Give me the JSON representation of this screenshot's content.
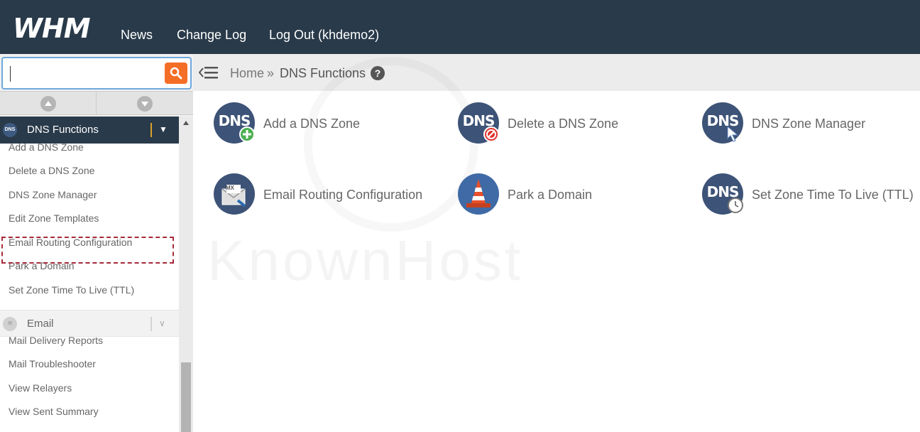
{
  "header": {
    "logo": "WHM",
    "nav": [
      {
        "label": "News"
      },
      {
        "label": "Change Log"
      },
      {
        "label": "Log Out (khdemo2)"
      }
    ]
  },
  "search": {
    "value": "",
    "placeholder": ""
  },
  "sidebar": {
    "categories": [
      {
        "icon_text": "DNS",
        "label": "DNS Functions",
        "items": [
          "Add a DNS Zone",
          "Delete a DNS Zone",
          "DNS Zone Manager",
          "Edit Zone Templates",
          "Email Routing Configuration",
          "Park a Domain",
          "Set Zone Time To Live (TTL)"
        ]
      },
      {
        "label": "Email",
        "items": [
          "Mail Delivery Reports",
          "Mail Troubleshooter",
          "View Relayers",
          "View Sent Summary"
        ]
      }
    ],
    "highlighted_item": "Email Routing Configuration"
  },
  "breadcrumb": {
    "home": "Home",
    "separator": "»",
    "current": "DNS Functions",
    "help": "?"
  },
  "watermark": {
    "text": "KnownHost"
  },
  "tiles": [
    {
      "label": "Add a DNS Zone",
      "icon_text": "DNS",
      "icon": "dns-add-icon"
    },
    {
      "label": "Delete a DNS Zone",
      "icon_text": "DNS",
      "icon": "dns-delete-icon"
    },
    {
      "label": "DNS Zone Manager",
      "icon_text": "DNS",
      "icon": "dns-zone-manager-icon"
    },
    {
      "label": "Email Routing Configuration",
      "icon_text": "MX",
      "icon": "email-routing-icon"
    },
    {
      "label": "Park a Domain",
      "icon": "traffic-cone-icon"
    },
    {
      "label": "Set Zone Time To Live (TTL)",
      "icon_text": "DNS",
      "icon": "dns-ttl-icon"
    }
  ],
  "colors": {
    "header_bg": "#293a4a",
    "accent_orange": "#f56e26",
    "highlight_border": "#a62a3a",
    "icon_navy": "#3d5377"
  }
}
